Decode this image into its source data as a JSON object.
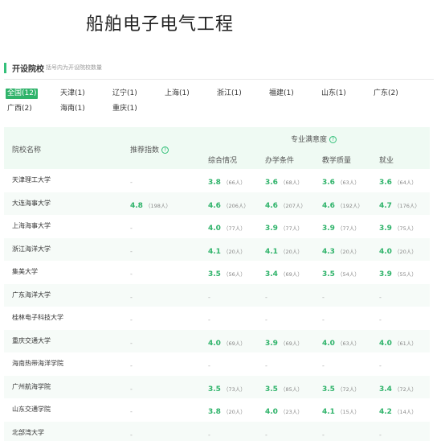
{
  "page_title": "船舶电子电气工程",
  "section": {
    "title": "开设院校",
    "subtitle": "括号内为开设院校数量"
  },
  "regions": [
    "全国(12)",
    "天津(1)",
    "辽宁(1)",
    "上海(1)",
    "浙江(1)",
    "福建(1)",
    "山东(1)",
    "广东(2)",
    "广西(2)",
    "海南(1)",
    "重庆(1)"
  ],
  "table": {
    "header": {
      "school": "院校名称",
      "recommend": "推荐指数",
      "satisfaction": "专业满意度",
      "overall": "综合情况",
      "conditions": "办学条件",
      "quality": "教学质量",
      "employment": "就业",
      "help_icon": "question-circle-icon"
    },
    "rows": [
      {
        "name": "天津理工大学",
        "rec": "-",
        "rec_cnt": "",
        "overall": "3.8",
        "overall_cnt": "（66人）",
        "cond": "3.6",
        "cond_cnt": "（68人）",
        "qual": "3.6",
        "qual_cnt": "（63人）",
        "emp": "3.6",
        "emp_cnt": "（64人）"
      },
      {
        "name": "大连海事大学",
        "rec": "4.8",
        "rec_cnt": "（198人）",
        "overall": "4.6",
        "overall_cnt": "（206人）",
        "cond": "4.6",
        "cond_cnt": "（207人）",
        "qual": "4.6",
        "qual_cnt": "（192人）",
        "emp": "4.7",
        "emp_cnt": "（176人）"
      },
      {
        "name": "上海海事大学",
        "rec": "-",
        "rec_cnt": "",
        "overall": "4.0",
        "overall_cnt": "（77人）",
        "cond": "3.9",
        "cond_cnt": "（77人）",
        "qual": "3.9",
        "qual_cnt": "（77人）",
        "emp": "3.9",
        "emp_cnt": "（75人）"
      },
      {
        "name": "浙江海洋大学",
        "rec": "-",
        "rec_cnt": "",
        "overall": "4.1",
        "overall_cnt": "（20人）",
        "cond": "4.1",
        "cond_cnt": "（20人）",
        "qual": "4.3",
        "qual_cnt": "（20人）",
        "emp": "4.0",
        "emp_cnt": "（20人）"
      },
      {
        "name": "集美大学",
        "rec": "-",
        "rec_cnt": "",
        "overall": "3.5",
        "overall_cnt": "（56人）",
        "cond": "3.4",
        "cond_cnt": "（69人）",
        "qual": "3.5",
        "qual_cnt": "（54人）",
        "emp": "3.9",
        "emp_cnt": "（55人）"
      },
      {
        "name": "广东海洋大学",
        "rec": "-",
        "rec_cnt": "",
        "overall": "-",
        "overall_cnt": "",
        "cond": "-",
        "cond_cnt": "",
        "qual": "-",
        "qual_cnt": "",
        "emp": "-",
        "emp_cnt": ""
      },
      {
        "name": "桂林电子科技大学",
        "rec": "-",
        "rec_cnt": "",
        "overall": "-",
        "overall_cnt": "",
        "cond": "-",
        "cond_cnt": "",
        "qual": "-",
        "qual_cnt": "",
        "emp": "-",
        "emp_cnt": ""
      },
      {
        "name": "重庆交通大学",
        "rec": "-",
        "rec_cnt": "",
        "overall": "4.0",
        "overall_cnt": "（69人）",
        "cond": "3.9",
        "cond_cnt": "（69人）",
        "qual": "4.0",
        "qual_cnt": "（63人）",
        "emp": "4.0",
        "emp_cnt": "（61人）"
      },
      {
        "name": "海南热带海洋学院",
        "rec": "-",
        "rec_cnt": "",
        "overall": "-",
        "overall_cnt": "",
        "cond": "-",
        "cond_cnt": "",
        "qual": "-",
        "qual_cnt": "",
        "emp": "-",
        "emp_cnt": ""
      },
      {
        "name": "广州航海学院",
        "rec": "-",
        "rec_cnt": "",
        "overall": "3.5",
        "overall_cnt": "（73人）",
        "cond": "3.5",
        "cond_cnt": "（85人）",
        "qual": "3.5",
        "qual_cnt": "（72人）",
        "emp": "3.4",
        "emp_cnt": "（72人）"
      },
      {
        "name": "山东交通学院",
        "rec": "-",
        "rec_cnt": "",
        "overall": "3.8",
        "overall_cnt": "（20人）",
        "cond": "4.0",
        "cond_cnt": "（23人）",
        "qual": "4.1",
        "qual_cnt": "（15人）",
        "emp": "4.2",
        "emp_cnt": "（14人）"
      },
      {
        "name": "北部湾大学",
        "rec": "-",
        "rec_cnt": "",
        "overall": "-",
        "overall_cnt": "",
        "cond": "-",
        "cond_cnt": "",
        "qual": "-",
        "qual_cnt": "",
        "emp": "-",
        "emp_cnt": ""
      }
    ]
  },
  "colors": {
    "accent": "#2fb36a",
    "header_bg": "#effaf3",
    "alt_row_bg": "#f6fbf8"
  }
}
